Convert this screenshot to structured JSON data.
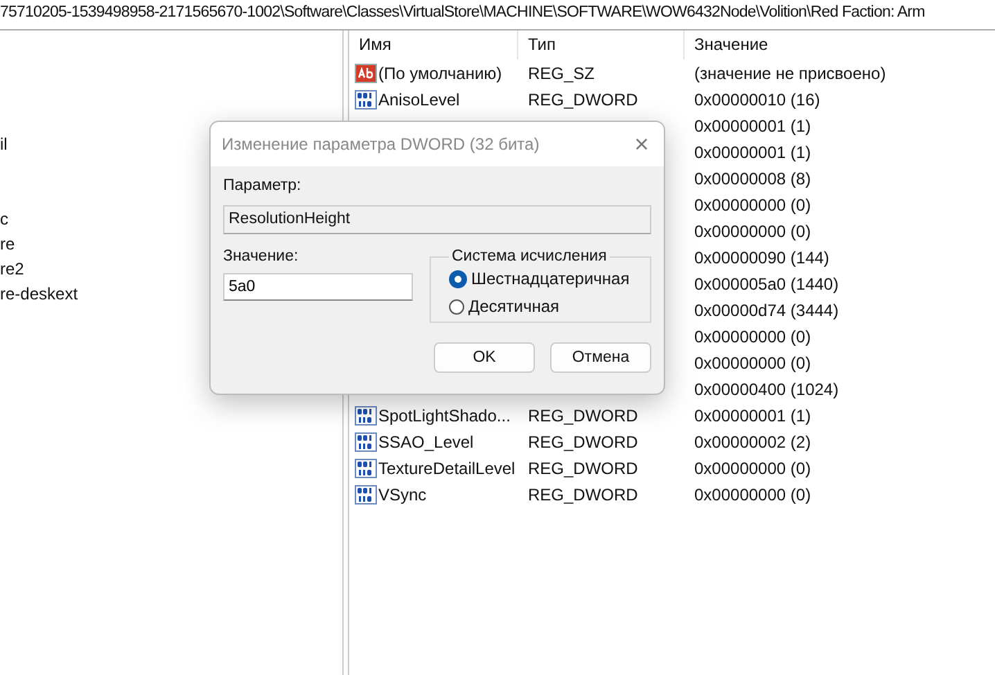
{
  "address_bar": {
    "path": "75710205-1539498958-2171565670-1002\\Software\\Classes\\VirtualStore\\MACHINE\\SOFTWARE\\WOW6432Node\\Volition\\Red Faction: Arm"
  },
  "tree": {
    "items": [
      {
        "label": "il"
      },
      {
        "label": "c"
      },
      {
        "label": "re"
      },
      {
        "label": "re2"
      },
      {
        "label": "re-deskext"
      }
    ]
  },
  "table": {
    "columns": [
      "Имя",
      "Тип",
      "Значение"
    ],
    "rows": [
      {
        "kind": "string",
        "name": "(По умолчанию)",
        "type": "REG_SZ",
        "value": "(значение не присвоено)"
      },
      {
        "kind": "dword",
        "name": "AnisoLevel",
        "type": "REG_DWORD",
        "value": "0x00000010 (16)"
      },
      {
        "kind": "hidden",
        "value": "0x00000001 (1)"
      },
      {
        "kind": "hidden",
        "value": "0x00000001 (1)"
      },
      {
        "kind": "hidden",
        "value": "0x00000008 (8)"
      },
      {
        "kind": "hidden",
        "value": "0x00000000 (0)"
      },
      {
        "kind": "hidden",
        "value": "0x00000000 (0)"
      },
      {
        "kind": "hidden",
        "value": "0x00000090 (144)"
      },
      {
        "kind": "hidden",
        "value": "0x000005a0 (1440)"
      },
      {
        "kind": "hidden",
        "value": "0x00000d74 (3444)"
      },
      {
        "kind": "hidden",
        "value": "0x00000000 (0)"
      },
      {
        "kind": "hidden",
        "value": "0x00000000 (0)"
      },
      {
        "kind": "hidden",
        "value": "0x00000400 (1024)"
      },
      {
        "kind": "dword",
        "name": "SpotLightShado...",
        "type": "REG_DWORD",
        "value": "0x00000001 (1)"
      },
      {
        "kind": "dword",
        "name": "SSAO_Level",
        "type": "REG_DWORD",
        "value": "0x00000002 (2)"
      },
      {
        "kind": "dword",
        "name": "TextureDetailLevel",
        "type": "REG_DWORD",
        "value": "0x00000000 (0)"
      },
      {
        "kind": "dword",
        "name": "VSync",
        "type": "REG_DWORD",
        "value": "0x00000000 (0)"
      }
    ]
  },
  "dialog": {
    "title": "Изменение параметра DWORD (32 бита)",
    "close": "×",
    "param_label": "Параметр:",
    "param_value": "ResolutionHeight",
    "value_label": "Значение:",
    "value": "5a0",
    "base_group": "Система исчисления",
    "bases": [
      {
        "label": "Шестнадцатеричная",
        "selected": true
      },
      {
        "label": "Десятичная",
        "selected": false
      }
    ],
    "buttons": [
      "OK",
      "Отмена"
    ]
  }
}
